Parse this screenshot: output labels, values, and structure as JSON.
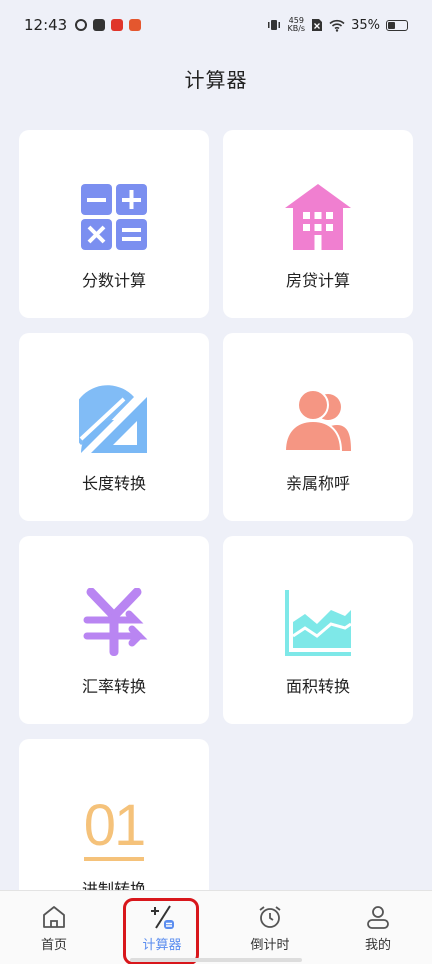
{
  "status": {
    "time": "12:43",
    "net_speed_top": "459",
    "net_speed_bottom": "KB/s",
    "battery": "35%"
  },
  "page": {
    "title": "计算器"
  },
  "tools": [
    {
      "label": "分数计算",
      "icon": "fraction-calc-icon"
    },
    {
      "label": "房贷计算",
      "icon": "house-icon"
    },
    {
      "label": "长度转换",
      "icon": "ruler-protractor-icon"
    },
    {
      "label": "亲属称呼",
      "icon": "people-icon"
    },
    {
      "label": "汇率转换",
      "icon": "yen-exchange-icon"
    },
    {
      "label": "面积转换",
      "icon": "area-chart-icon"
    },
    {
      "label": "进制转换",
      "icon": "binary-01-icon",
      "icon_text": "01"
    }
  ],
  "colors": {
    "fraction": "#7b8ff0",
    "house": "#f07fd0",
    "ruler": "#7ab8f5",
    "people": "#f59683",
    "yen": "#b985f2",
    "area": "#7ee8e8",
    "binary": "#f5c27a",
    "accent": "#5b8def"
  },
  "tabbar": {
    "items": [
      {
        "label": "首页",
        "icon": "home-icon"
      },
      {
        "label": "计算器",
        "icon": "calculator-icon",
        "active": true
      },
      {
        "label": "倒计时",
        "icon": "alarm-clock-icon"
      },
      {
        "label": "我的",
        "icon": "profile-icon"
      }
    ]
  }
}
